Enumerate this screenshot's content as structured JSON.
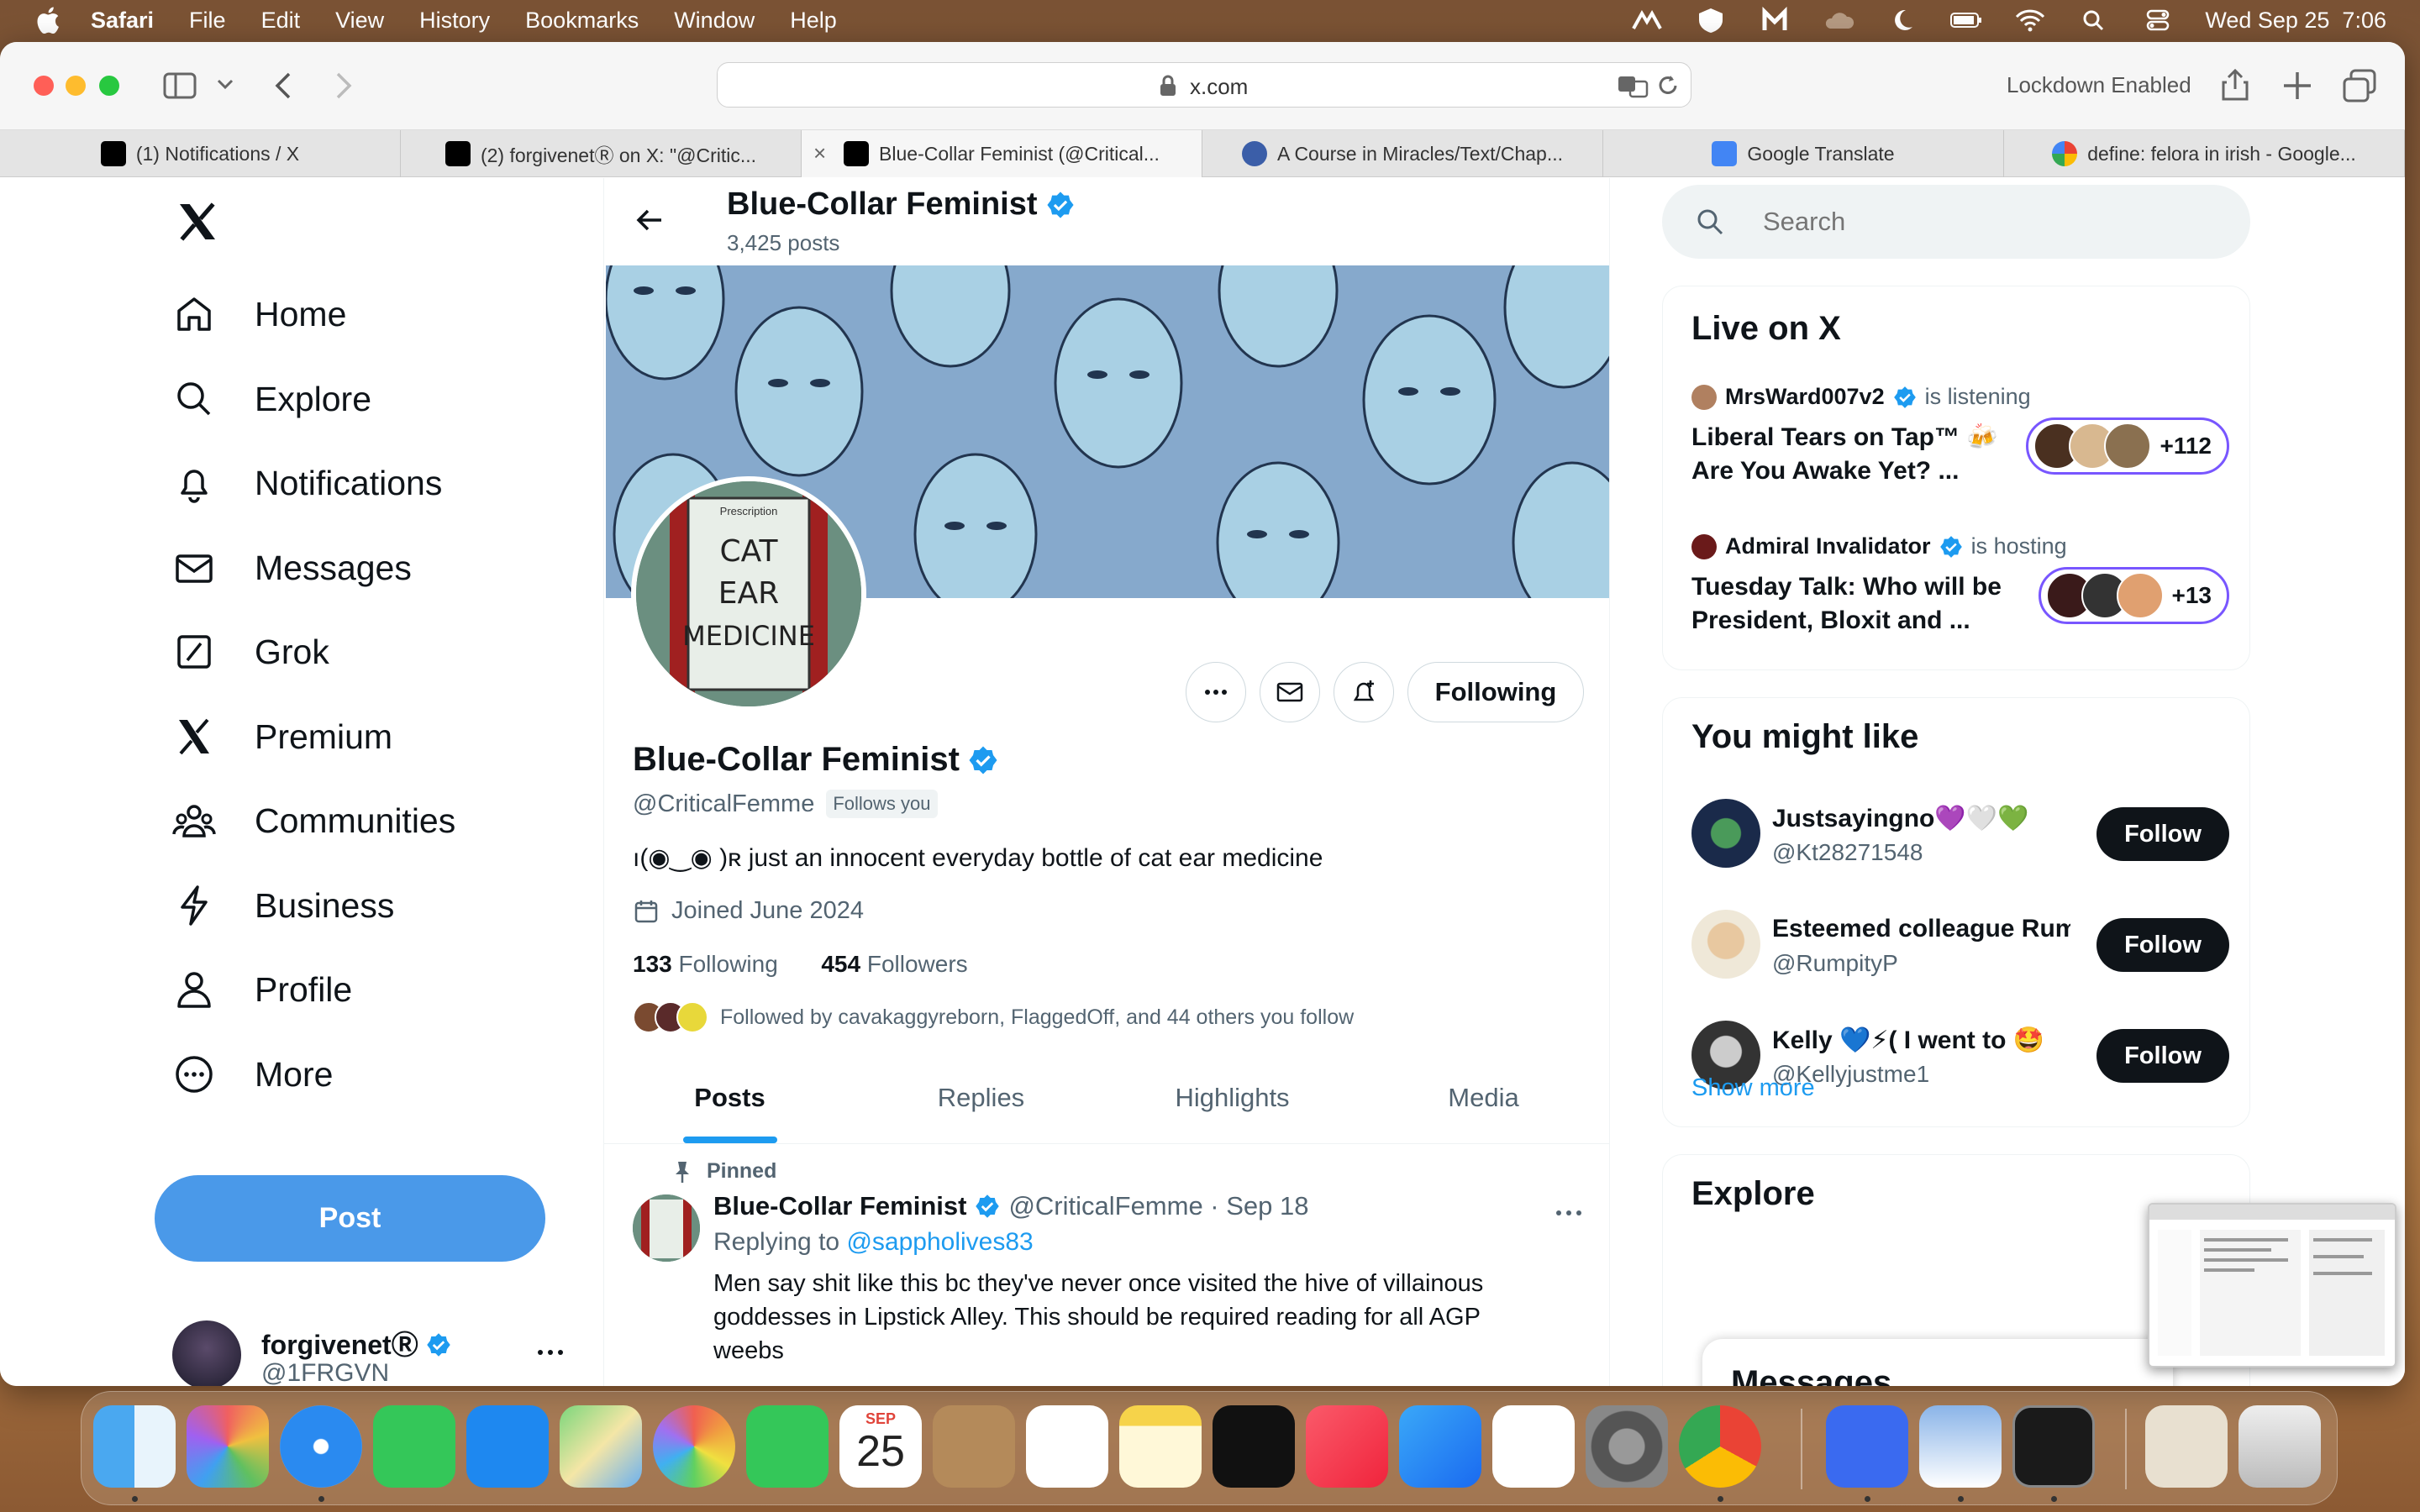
{
  "menubar": {
    "app": "Safari",
    "items": [
      "File",
      "Edit",
      "View",
      "History",
      "Bookmarks",
      "Window",
      "Help"
    ],
    "datetime": "Wed Sep 25  7:06"
  },
  "browser": {
    "url": "x.com",
    "lockdown": "Lockdown Enabled",
    "tabs": [
      {
        "title": "(1) Notifications / X",
        "favicon": "x-icon"
      },
      {
        "title": "(2) forgivenetⓇ on X: \"@Critic...",
        "favicon": "x-icon"
      },
      {
        "title": "Blue-Collar Feminist (@Critical...",
        "favicon": "x-icon",
        "active": true
      },
      {
        "title": "A Course in Miracles/Text/Chap...",
        "favicon": "acim-icon"
      },
      {
        "title": "Google Translate",
        "favicon": "translate-icon"
      },
      {
        "title": "define: felora in irish  - Google...",
        "favicon": "google-icon"
      }
    ]
  },
  "nav": {
    "items": [
      {
        "label": "Home",
        "icon": "home-icon"
      },
      {
        "label": "Explore",
        "icon": "search-icon"
      },
      {
        "label": "Notifications",
        "icon": "bell-icon"
      },
      {
        "label": "Messages",
        "icon": "mail-icon"
      },
      {
        "label": "Grok",
        "icon": "grok-icon"
      },
      {
        "label": "Premium",
        "icon": "x-icon"
      },
      {
        "label": "Communities",
        "icon": "communities-icon"
      },
      {
        "label": "Business",
        "icon": "lightning-icon"
      },
      {
        "label": "Profile",
        "icon": "person-icon"
      },
      {
        "label": "More",
        "icon": "more-circle-icon"
      }
    ],
    "post_label": "Post",
    "account": {
      "name": "forgivenetⓇ",
      "handle": "@1FRGVN"
    }
  },
  "profile": {
    "header_name": "Blue-Collar Feminist",
    "post_count": "3,425 posts",
    "avatar_text": [
      "CAT",
      "EAR",
      "MEDICINE"
    ],
    "avatar_label": "Prescription",
    "following_label": "Following",
    "name": "Blue-Collar Feminist",
    "handle": "@CriticalFemme",
    "follows_you": "Follows you",
    "bio": "ı(◉‿◉ )ʀ  just an innocent everyday bottle of cat ear medicine",
    "joined": "Joined June 2024",
    "following_count": "133",
    "following_text": "Following",
    "followers_count": "454",
    "followers_text": "Followers",
    "followed_by": "Followed by cavakaggyreborn, FlaggedOff, and 44 others you follow",
    "tabs": [
      "Posts",
      "Replies",
      "Highlights",
      "Media"
    ]
  },
  "tweet": {
    "pinned": "Pinned",
    "name": "Blue-Collar Feminist",
    "meta": "@CriticalFemme · Sep 18",
    "replying_prefix": "Replying to ",
    "replying_to": "@sappholives83",
    "text": "Men say shit like this bc they've never once visited the hive of villainous goddesses in Lipstick Alley. This should be required reading for all AGP weebs"
  },
  "sidebar": {
    "search_placeholder": "Search",
    "live_title": "Live on X",
    "live": [
      {
        "host": "MrsWard007v2",
        "status": "is listening",
        "title": "Liberal Tears on Tap™ 🍻 Are You Awake Yet? ...",
        "count": "+112"
      },
      {
        "host": "Admiral Invalidator",
        "status": "is hosting",
        "title": "Tuesday Talk: Who will be President, Bloxit and ...",
        "count": "+13"
      }
    ],
    "suggest_title": "You might like",
    "suggestions": [
      {
        "name": "Justsayingno💜🤍💚",
        "handle": "@Kt28271548",
        "button": "Follow"
      },
      {
        "name": "Esteemed colleague Rumpity",
        "handle": "@RumpityP",
        "button": "Follow"
      },
      {
        "name": "Kelly 💙⚡( I went to 🤩",
        "handle": "@Kellyjustme1",
        "button": "Follow"
      }
    ],
    "show_more": "Show more",
    "explore_title": "Explore",
    "messages_title": "Messages"
  },
  "dock": {
    "calendar_month": "SEP",
    "calendar_day": "25",
    "apps": [
      "finder-icon",
      "launchpad-icon",
      "safari-icon",
      "messages-icon",
      "mail-icon",
      "maps-icon",
      "photos-icon",
      "facetime-icon",
      "calendar-icon",
      "contacts-icon",
      "reminders-icon",
      "notes-icon",
      "tv-icon",
      "music-icon",
      "appstore-icon",
      "freeform-icon",
      "settings-icon",
      "chrome-icon",
      "app-icon",
      "preview-icon",
      "activity-monitor-icon",
      "downloads-icon",
      "trash-icon"
    ]
  },
  "colors": {
    "accent": "#1d9bf0",
    "post_button": "#4a99e9",
    "verified": "#1d9bf0",
    "live_border": "#7856ff"
  }
}
